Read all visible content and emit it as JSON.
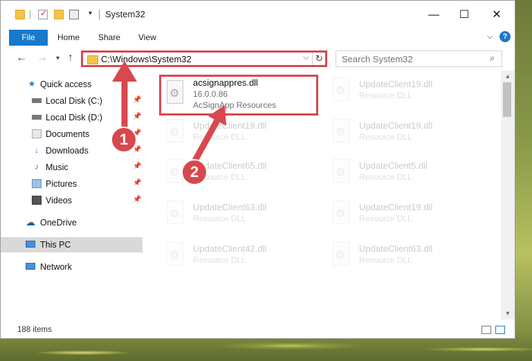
{
  "window": {
    "title": "System32",
    "controls": {
      "minimize": "—",
      "maximize": "☐",
      "close": "✕"
    }
  },
  "ribbon": {
    "tabs": [
      "File",
      "Home",
      "Share",
      "View"
    ],
    "help": "?"
  },
  "navigation": {
    "address": "C:\\Windows\\System32",
    "search_placeholder": "Search System32"
  },
  "sidebar": {
    "items": [
      {
        "label": "Quick access",
        "icon": "star-icon",
        "pinned": false
      },
      {
        "label": "Local Disk (C:)",
        "icon": "drive-icon",
        "pinned": true
      },
      {
        "label": "Local Disk (D:)",
        "icon": "drive-icon",
        "pinned": true
      },
      {
        "label": "Documents",
        "icon": "documents-icon",
        "pinned": true
      },
      {
        "label": "Downloads",
        "icon": "download-icon",
        "pinned": true
      },
      {
        "label": "Music",
        "icon": "music-icon",
        "pinned": true
      },
      {
        "label": "Pictures",
        "icon": "pictures-icon",
        "pinned": true
      },
      {
        "label": "Videos",
        "icon": "videos-icon",
        "pinned": true
      },
      {
        "label": "OneDrive",
        "icon": "cloud-icon",
        "pinned": false
      },
      {
        "label": "This PC",
        "icon": "computer-icon",
        "pinned": false,
        "selected": true
      },
      {
        "label": "Network",
        "icon": "network-icon",
        "pinned": false
      }
    ]
  },
  "files": {
    "highlighted": {
      "name": "acsignappres.dll",
      "version": "16.0.0.86",
      "description": "AcSignApp Resources"
    },
    "faded": [
      {
        "name": "UpdateClient19.dll",
        "type": "Resource DLL"
      },
      {
        "name": "UpdateClient19.dll",
        "type": "Resource DLL"
      },
      {
        "name": "UpdateClient19.dll",
        "type": "Resource DLL"
      },
      {
        "name": "UpdateClient65.dll",
        "type": "Resource DLL"
      },
      {
        "name": "UpdateClient5.dll",
        "type": "Resource DLL"
      },
      {
        "name": "UpdateClient63.dll",
        "type": "Resource DLL"
      },
      {
        "name": "UpdateClient19.dll",
        "type": "Resource DLL"
      },
      {
        "name": "UpdateClient42.dll",
        "type": "Resource DLL"
      },
      {
        "name": "UpdateClient63.dll",
        "type": "Resource DLL"
      }
    ]
  },
  "status": {
    "item_count": "188 items"
  },
  "annotations": {
    "step1": "1",
    "step2": "2",
    "color": "#d9474f"
  }
}
